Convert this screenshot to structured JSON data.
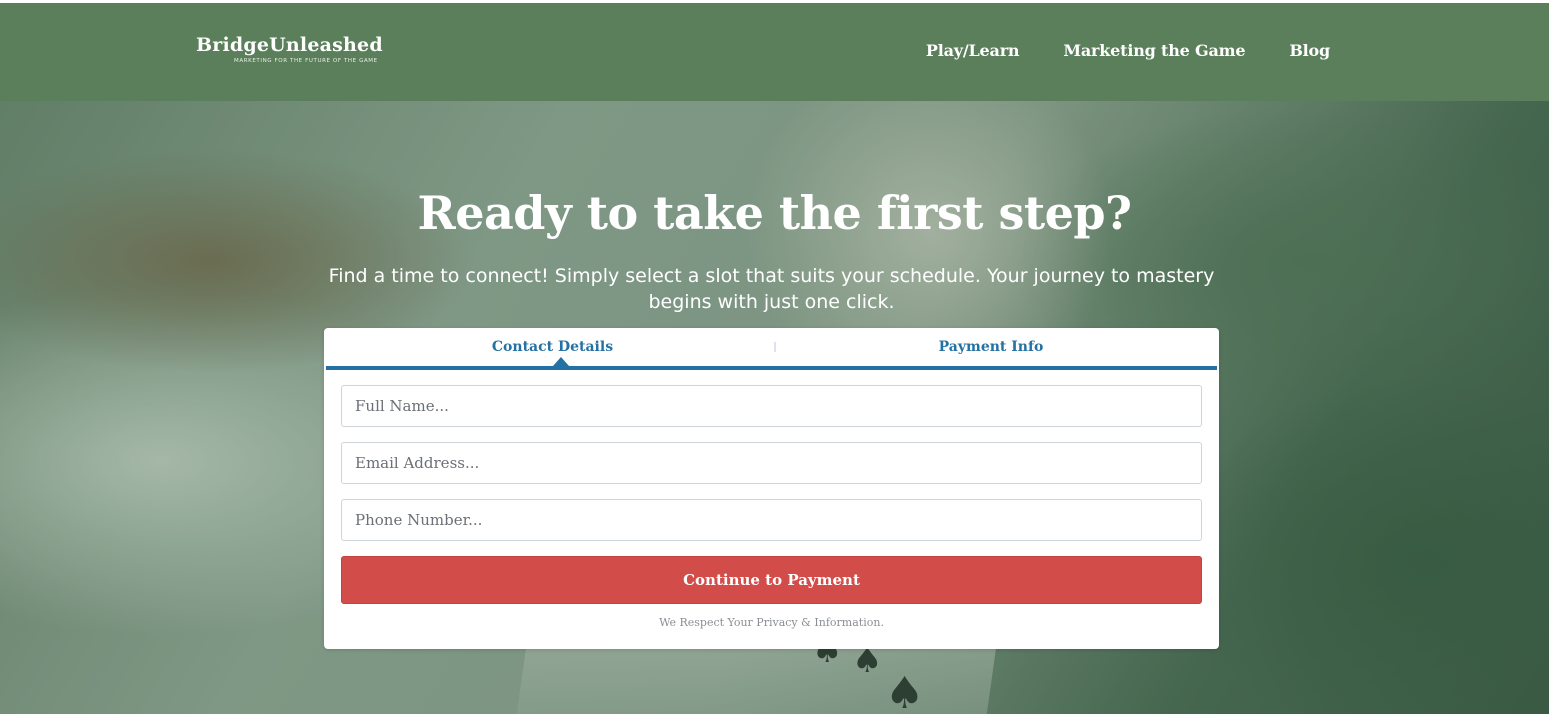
{
  "header": {
    "brand": "BridgeUnleashed",
    "tagline": "MARKETING FOR THE FUTURE OF THE GAME",
    "nav": [
      {
        "label": "Play/Learn"
      },
      {
        "label": "Marketing the Game"
      },
      {
        "label": "Blog"
      }
    ],
    "bg_color": "#5a7f5a"
  },
  "hero": {
    "title": "Ready to take the first step?",
    "subtitle": "Find a time to connect! Simply select a slot that suits your schedule. Your journey to mastery begins with just one click.",
    "background": "blurred photo of playing cards on a green table"
  },
  "form": {
    "tabs": [
      {
        "label": "Contact Details",
        "active": true
      },
      {
        "label": "Payment Info",
        "active": false
      }
    ],
    "fields": {
      "full_name": {
        "placeholder": "Full Name...",
        "value": ""
      },
      "email": {
        "placeholder": "Email Address...",
        "value": ""
      },
      "phone": {
        "placeholder": "Phone Number...",
        "value": ""
      }
    },
    "submit_label": "Continue to Payment",
    "privacy_note": "We Respect Your Privacy & Information.",
    "accent_color": "#2471a3",
    "button_color": "#d24d4a"
  }
}
